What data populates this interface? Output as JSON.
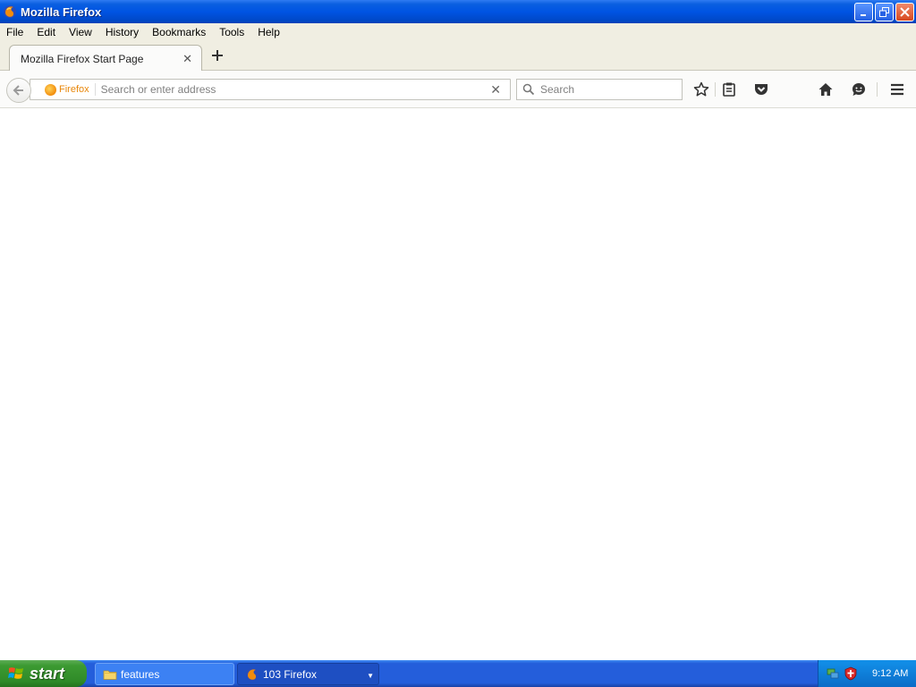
{
  "window": {
    "title": "Mozilla Firefox"
  },
  "menu": {
    "items": [
      "File",
      "Edit",
      "View",
      "History",
      "Bookmarks",
      "Tools",
      "Help"
    ]
  },
  "tabs": {
    "active": {
      "label": "Mozilla Firefox Start Page"
    }
  },
  "navbar": {
    "identity_label": "Firefox",
    "url_placeholder": "Search or enter address",
    "search_placeholder": "Search"
  },
  "taskbar": {
    "start_label": "start",
    "tasks": [
      {
        "label": "features",
        "icon": "folder-icon"
      },
      {
        "label": "103 Firefox",
        "icon": "firefox-icon"
      }
    ],
    "clock": "9:12 AM"
  },
  "colors": {
    "titlebar": "#0054e3",
    "chrome": "#f0eee2",
    "identity_orange": "#e8870b",
    "start_green": "#3c9a32",
    "taskbar_blue": "#245edb"
  }
}
